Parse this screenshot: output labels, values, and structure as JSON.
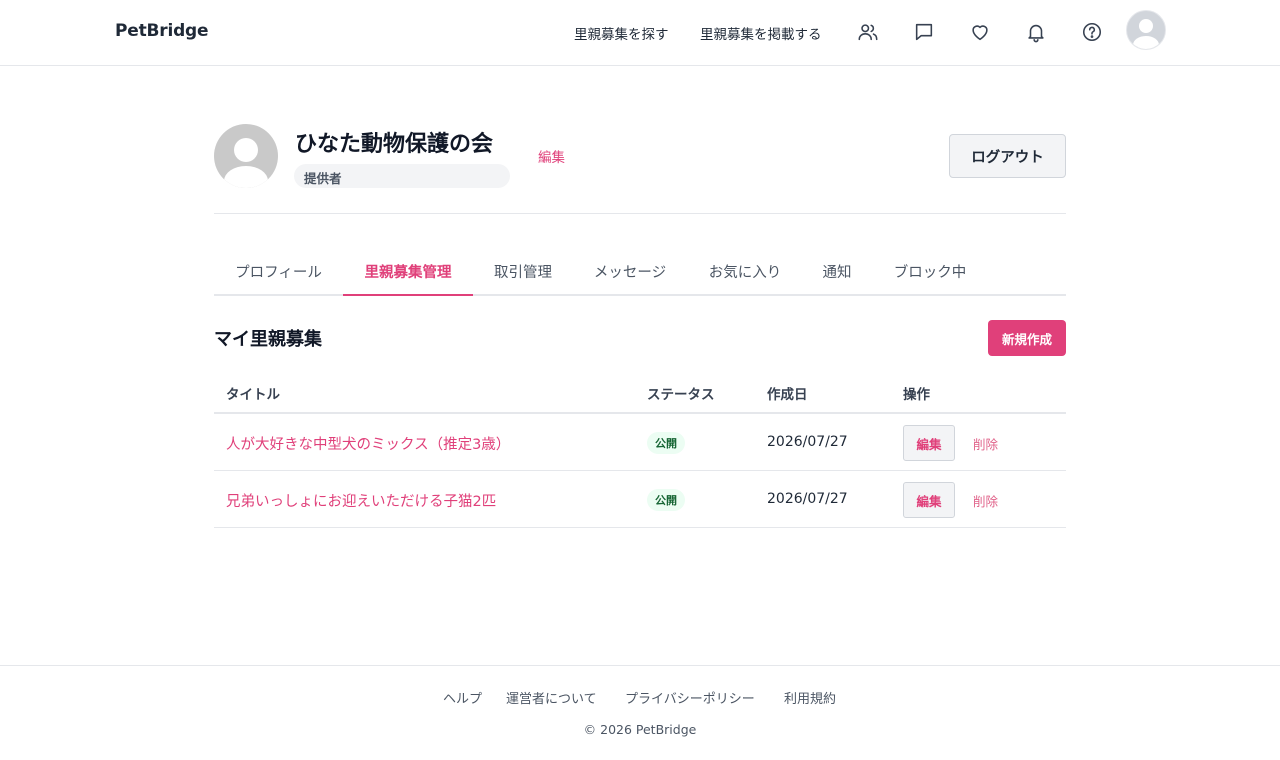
{
  "header": {
    "logo": "PetBridge",
    "nav": {
      "find_label": "里親募集を探す",
      "post_label": "里親募集を掲載する"
    },
    "icons": [
      "users-icon",
      "message-icon",
      "heart-icon",
      "bell-icon",
      "help-icon",
      "avatar"
    ]
  },
  "profile": {
    "name": "ひなた動物保護の会",
    "role": "提供者",
    "edit_label": "編集",
    "logout_label": "ログアウト"
  },
  "tabs": [
    {
      "label": "プロフィール",
      "active": false
    },
    {
      "label": "里親募集管理",
      "active": true
    },
    {
      "label": "取引管理",
      "active": false
    },
    {
      "label": "メッセージ",
      "active": false
    },
    {
      "label": "お気に入り",
      "active": false
    },
    {
      "label": "通知",
      "active": false
    },
    {
      "label": "ブロック中",
      "active": false
    }
  ],
  "section": {
    "title": "マイ里親募集",
    "new_label": "新規作成"
  },
  "table": {
    "headers": {
      "title": "タイトル",
      "status": "ステータス",
      "created": "作成日",
      "actions": "操作"
    },
    "rows": [
      {
        "title": "人が大好きな中型犬のミックス（推定3歳）",
        "status": "公開",
        "created": "2026/07/27",
        "edit": "編集",
        "delete": "削除"
      },
      {
        "title": "兄弟いっしょにお迎えいただける子猫2匹",
        "status": "公開",
        "created": "2026/07/27",
        "edit": "編集",
        "delete": "削除"
      }
    ]
  },
  "footer": {
    "links": [
      "ヘルプ",
      "運営者について",
      "プライバシーポリシー",
      "利用規約"
    ],
    "copyright": "© 2026 PetBridge"
  },
  "colors": {
    "accent": "#e0407a",
    "status_bg": "#ecfdf3",
    "status_text": "#166534"
  }
}
